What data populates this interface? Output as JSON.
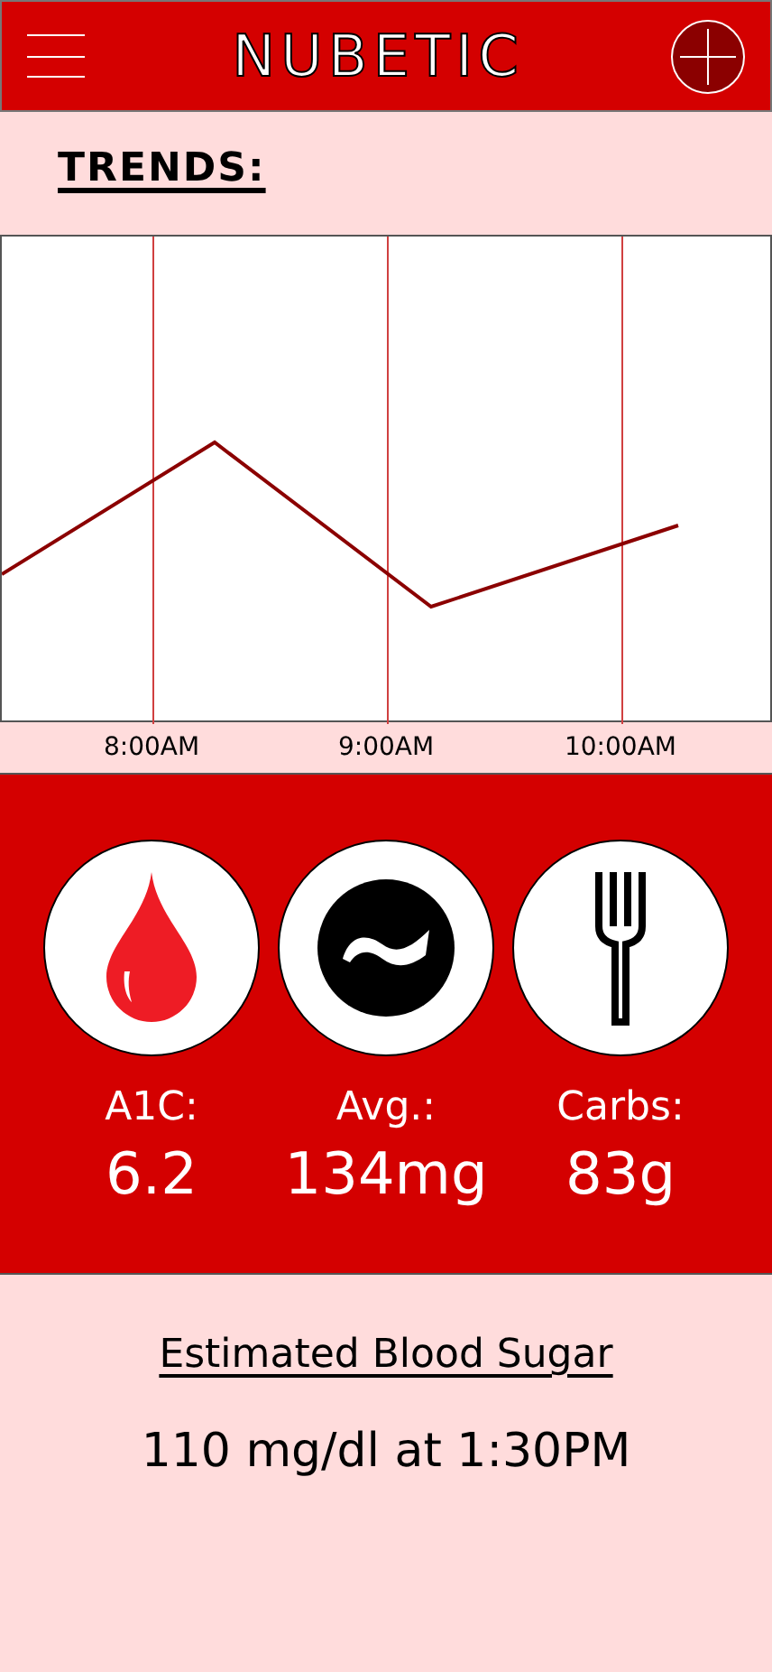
{
  "header": {
    "title": "NUBETIC"
  },
  "trends": {
    "heading": "TRENDS:",
    "time_labels": [
      "8:00AM",
      "9:00AM",
      "10:00AM"
    ]
  },
  "stats": [
    {
      "kind": "drop",
      "label": "A1C:",
      "value": "6.2"
    },
    {
      "kind": "wave",
      "label": "Avg.:",
      "value": "134mg"
    },
    {
      "kind": "fork",
      "label": "Carbs:",
      "value": "83g"
    }
  ],
  "estimate": {
    "heading": "Estimated Blood Sugar",
    "value": "110 mg/dl at 1:30PM"
  }
}
